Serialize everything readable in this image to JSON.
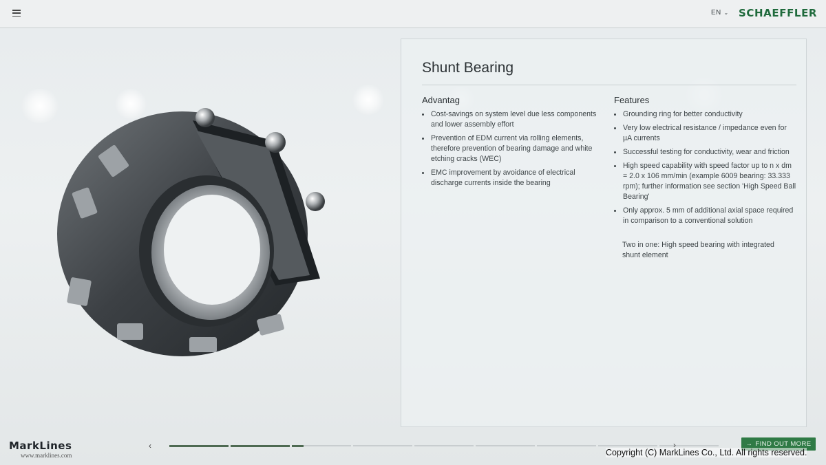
{
  "header": {
    "language": "EN",
    "brand": "SCHAEFFLER"
  },
  "panel": {
    "title": "Shunt Bearing",
    "advantages": {
      "heading": "Advantag",
      "items": [
        "Cost-savings on system level due less components and lower assembly effort",
        "Prevention of EDM current via rolling elements, therefore prevention of bearing damage and white etching cracks (WEC)",
        "EMC improvement by avoidance of electrical discharge currents inside the bearing"
      ]
    },
    "features": {
      "heading": "Features",
      "items": [
        "Grounding ring for better conductivity",
        "Very low electrical resistance / impedance even for µA currents",
        "Successful testing for conductivity, wear and friction",
        "High speed capability with speed factor up to n x dm = 2.0 x 106 mm/min (example 6009 bearing: 33.333 rpm); further information see section 'High Speed Ball Bearing'",
        "Only approx. 5 mm of additional axial space required in comparison to a conventional solution"
      ],
      "note": "Two in one: High speed bearing with integrated shunt element"
    }
  },
  "navigation": {
    "prev_symbol": "‹",
    "next_symbol": "›",
    "slides_total": 9,
    "slides_completed": 2.2,
    "cta_label": "FIND OUT MORE"
  },
  "watermark": {
    "logo": "MarkLines",
    "url": "www.marklines.com",
    "copyright": "Copyright (C) MarkLines Co., Ltd. All rights reserved."
  },
  "icons": {
    "menu": "hamburger-menu-icon",
    "language_chevron": "chevron-down-icon",
    "cta_arrow": "arrow-right-icon"
  },
  "colors": {
    "brand": "#1f6a3c",
    "cta": "#2f7a45",
    "progress_done": "#4e6a52"
  }
}
